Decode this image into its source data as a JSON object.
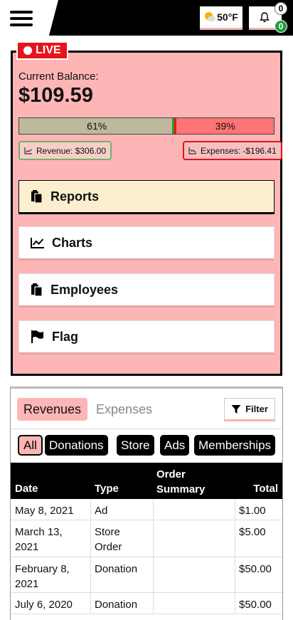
{
  "header": {
    "weather_temp": "50°F",
    "notification_count": "0",
    "status_count": "0"
  },
  "card": {
    "live_label": "LIVE",
    "balance_label": "Current Balance:",
    "balance_amount": "$109.59",
    "progress": {
      "revenue_percent": 61,
      "expense_percent": 39,
      "revenue_text": "61%",
      "expense_text": "39%"
    },
    "revenue_pill": "Revenue: $306.00",
    "expense_pill": "Expenses: -$196.41",
    "nav": [
      {
        "label": "Reports",
        "icon": "clipboard-icon",
        "active": true
      },
      {
        "label": "Charts",
        "icon": "line-chart-icon",
        "active": false
      },
      {
        "label": "Employees",
        "icon": "clipboard-icon",
        "active": false
      },
      {
        "label": "Flag",
        "icon": "flag-icon",
        "active": false
      }
    ]
  },
  "transactions": {
    "tabs": [
      "Revenues",
      "Expenses"
    ],
    "active_tab": "Revenues",
    "filter_label": "Filter",
    "chips": [
      "All",
      "Donations",
      "Store",
      "Ads",
      "Memberships"
    ],
    "active_chip": "All",
    "columns": [
      "Date",
      "Type",
      "Order\nSummary",
      "Total"
    ],
    "rows": [
      {
        "date": "May 8, 2021",
        "type": "Ad",
        "summary": "",
        "total": "$1.00"
      },
      {
        "date": "March 13, 2021",
        "type": "Store Order",
        "summary": "",
        "total": "$5.00"
      },
      {
        "date": "February 8, 2021",
        "type": "Donation",
        "summary": "",
        "total": "$50.00"
      },
      {
        "date": "July 6, 2020",
        "type": "Donation",
        "summary": "",
        "total": "$50.00"
      }
    ]
  },
  "colors": {
    "card_bg": "#fdb5b5",
    "live_red": "#e8141c",
    "revenue_bar": "#bdb99c",
    "expense_bar": "#ff7474",
    "badge_green": "#1e9e3a"
  }
}
